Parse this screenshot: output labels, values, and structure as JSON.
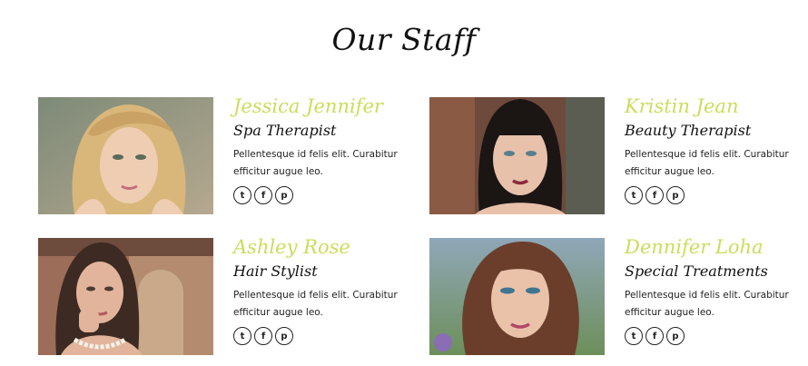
{
  "section": {
    "title": "Our Staff"
  },
  "staff": [
    {
      "name": "Jessica Jennifer",
      "role": "Spa Therapist",
      "description": "Pellentesque id felis elit. Curabitur efficitur augue leo.",
      "social": {
        "twitter": "twitter-icon",
        "facebook": "facebook-icon",
        "pinterest": "pinterest-icon"
      }
    },
    {
      "name": "Kristin Jean",
      "role": "Beauty Therapist",
      "description": "Pellentesque id felis elit. Curabitur efficitur augue leo.",
      "social": {
        "twitter": "twitter-icon",
        "facebook": "facebook-icon",
        "pinterest": "pinterest-icon"
      }
    },
    {
      "name": "Ashley Rose",
      "role": "Hair Stylist",
      "description": "Pellentesque id felis elit. Curabitur efficitur augue leo.",
      "social": {
        "twitter": "twitter-icon",
        "facebook": "facebook-icon",
        "pinterest": "pinterest-icon"
      }
    },
    {
      "name": "Dennifer Loha",
      "role": "Special Treatments",
      "description": "Pellentesque id felis elit. Curabitur efficitur augue leo.",
      "social": {
        "twitter": "twitter-icon",
        "facebook": "facebook-icon",
        "pinterest": "pinterest-icon"
      }
    }
  ],
  "colors": {
    "name_accent": "#cddc5b",
    "text": "#222222",
    "heading": "#111111"
  }
}
